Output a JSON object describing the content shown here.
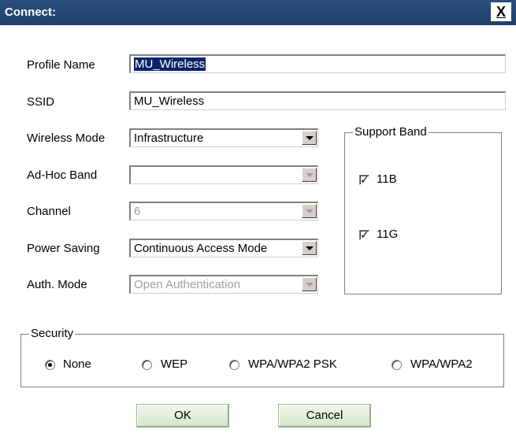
{
  "window": {
    "title": "Connect:",
    "close_label": "X"
  },
  "form": {
    "profile_name": {
      "label": "Profile Name",
      "value": "MU_Wireless"
    },
    "ssid": {
      "label": "SSID",
      "value": "MU_Wireless"
    },
    "wireless_mode": {
      "label": "Wireless Mode",
      "value": "Infrastructure"
    },
    "adhoc_band": {
      "label": "Ad-Hoc Band",
      "value": ""
    },
    "channel": {
      "label": "Channel",
      "value": "6"
    },
    "power_saving": {
      "label": "Power Saving",
      "value": "Continuous Access Mode"
    },
    "auth_mode": {
      "label": "Auth. Mode",
      "value": "Open Authentication"
    }
  },
  "support_band": {
    "legend": "Support Band",
    "options": [
      {
        "label": "11B",
        "checked": true
      },
      {
        "label": "11G",
        "checked": true
      }
    ]
  },
  "security": {
    "legend": "Security",
    "options": [
      {
        "label": "None",
        "selected": true
      },
      {
        "label": "WEP",
        "selected": false
      },
      {
        "label": "WPA/WPA2 PSK",
        "selected": false
      },
      {
        "label": "WPA/WPA2",
        "selected": false
      }
    ]
  },
  "buttons": {
    "ok": "OK",
    "cancel": "Cancel"
  },
  "colors": {
    "titlebar": "#1f3f68",
    "selection": "#0a246a",
    "button_fill": "#d6e6c9"
  }
}
